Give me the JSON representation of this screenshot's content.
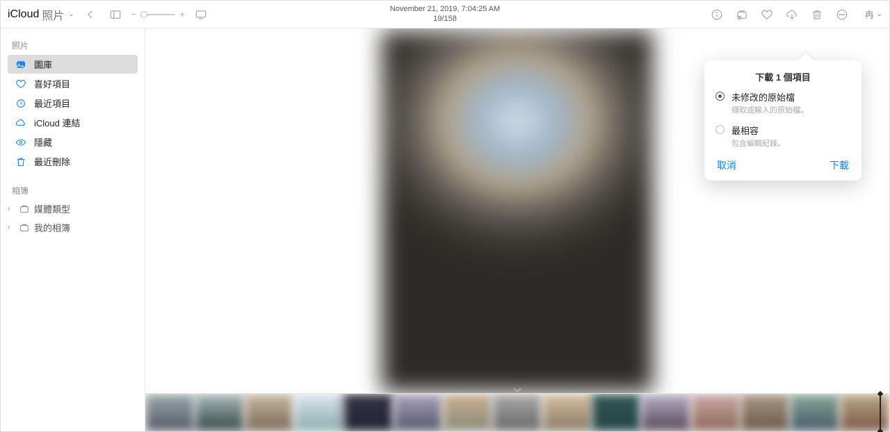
{
  "app": {
    "name": "iCloud",
    "section": "照片"
  },
  "toolbar": {
    "timestamp": "November 21, 2019, 7:04:25 AM",
    "counter": "19/158",
    "user_initial": "冉"
  },
  "sidebar": {
    "section_photos": "照片",
    "items": [
      {
        "id": "library",
        "label": "圖庫",
        "selected": true
      },
      {
        "id": "favorites",
        "label": "喜好項目"
      },
      {
        "id": "recents",
        "label": "最近項目"
      },
      {
        "id": "icloud-links",
        "label": "iCloud 連結"
      },
      {
        "id": "hidden",
        "label": "隱藏"
      },
      {
        "id": "recently-deleted",
        "label": "最近刪除"
      }
    ],
    "section_albums": "相簿",
    "albums": [
      {
        "id": "media-types",
        "label": "媒體類型"
      },
      {
        "id": "my-albums",
        "label": "我的相簿"
      }
    ]
  },
  "popover": {
    "title": "下載 1 個項目",
    "options": [
      {
        "title": "未修改的原始檔",
        "desc": "擷取或輸入的原始檔。",
        "selected": true
      },
      {
        "title": "最相容",
        "desc": "包含編輯紀錄。",
        "selected": false
      }
    ],
    "cancel": "取消",
    "confirm": "下載"
  }
}
